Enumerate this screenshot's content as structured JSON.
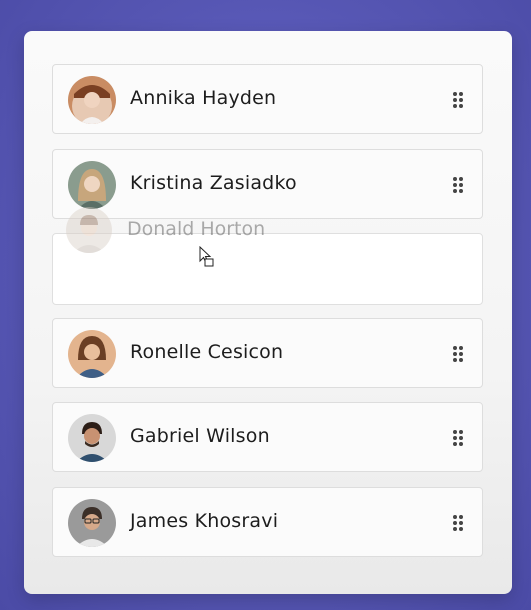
{
  "list": {
    "items": [
      {
        "name": "Annika Hayden",
        "avatar_icon": "avatar-woman-brown-hat"
      },
      {
        "name": "Kristina Zasiadko",
        "avatar_icon": "avatar-woman-blonde"
      },
      {
        "name": "Ronelle Cesicon",
        "avatar_icon": "avatar-woman-denim"
      },
      {
        "name": "Gabriel Wilson",
        "avatar_icon": "avatar-man-beard"
      },
      {
        "name": "James Khosravi",
        "avatar_icon": "avatar-man-glasses"
      }
    ],
    "dragging": {
      "name": "Donald Horton",
      "avatar_icon": "avatar-man-faded"
    },
    "handle_icon": "drag-handle-icon"
  },
  "colors": {
    "background": "#5a5ab8",
    "card": "#f5f5f5",
    "item_border": "#dddddd",
    "text": "#1d1d1d"
  }
}
